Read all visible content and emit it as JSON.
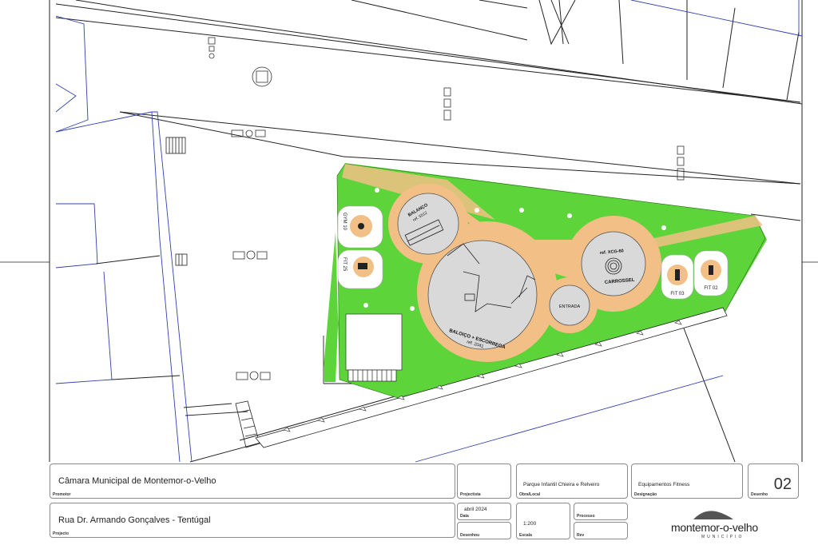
{
  "plan": {
    "labels": {
      "balanco": "BALANÇO",
      "balanco_ref": "ref. 5512",
      "baloico": "BALOIÇO + ESCORREGA",
      "baloico_ref": "ref. 2041",
      "entrada": "ENTRADA",
      "carrossel_ref": "ref. XCG-60",
      "carrossel": "CARROSSEL",
      "fit03": "FIT 03",
      "fit02": "FIT 02",
      "gym10": "GYM 10",
      "fit25": "FIT 25"
    },
    "colors": {
      "grass": "#5cd43a",
      "path": "#f2bf86",
      "play_area": "#d9d9d9",
      "linework": "#1a1a1a",
      "blue_linework": "#3040b0"
    }
  },
  "title_block": {
    "promotor": {
      "value": "Câmara Municipal de Montemor-o-Velho",
      "caption": "Promotor"
    },
    "projeto": {
      "value": "Rua Dr. Armando Gonçalves - Tentúgal",
      "caption": "Projecto"
    },
    "projetista": {
      "caption": "Projectista"
    },
    "local": {
      "value": "Parque Infantil Chieira e Relveiro",
      "caption": "Obra/Local"
    },
    "designacao": {
      "value": "Equipamentos Fitness",
      "caption": "Designação"
    },
    "desenho": {
      "value": "02",
      "caption": "Desenho"
    },
    "data": {
      "value": "abril 2024",
      "caption": "Data"
    },
    "desenhou": {
      "caption": "Desenhou"
    },
    "escala": {
      "value": "1:200",
      "caption": "Escala"
    },
    "processo": {
      "caption": "Processo"
    },
    "rev": {
      "caption": "Rev"
    }
  },
  "logo": {
    "name": "montemor-o-velho",
    "subtitle": "MUNICÍPIO"
  }
}
